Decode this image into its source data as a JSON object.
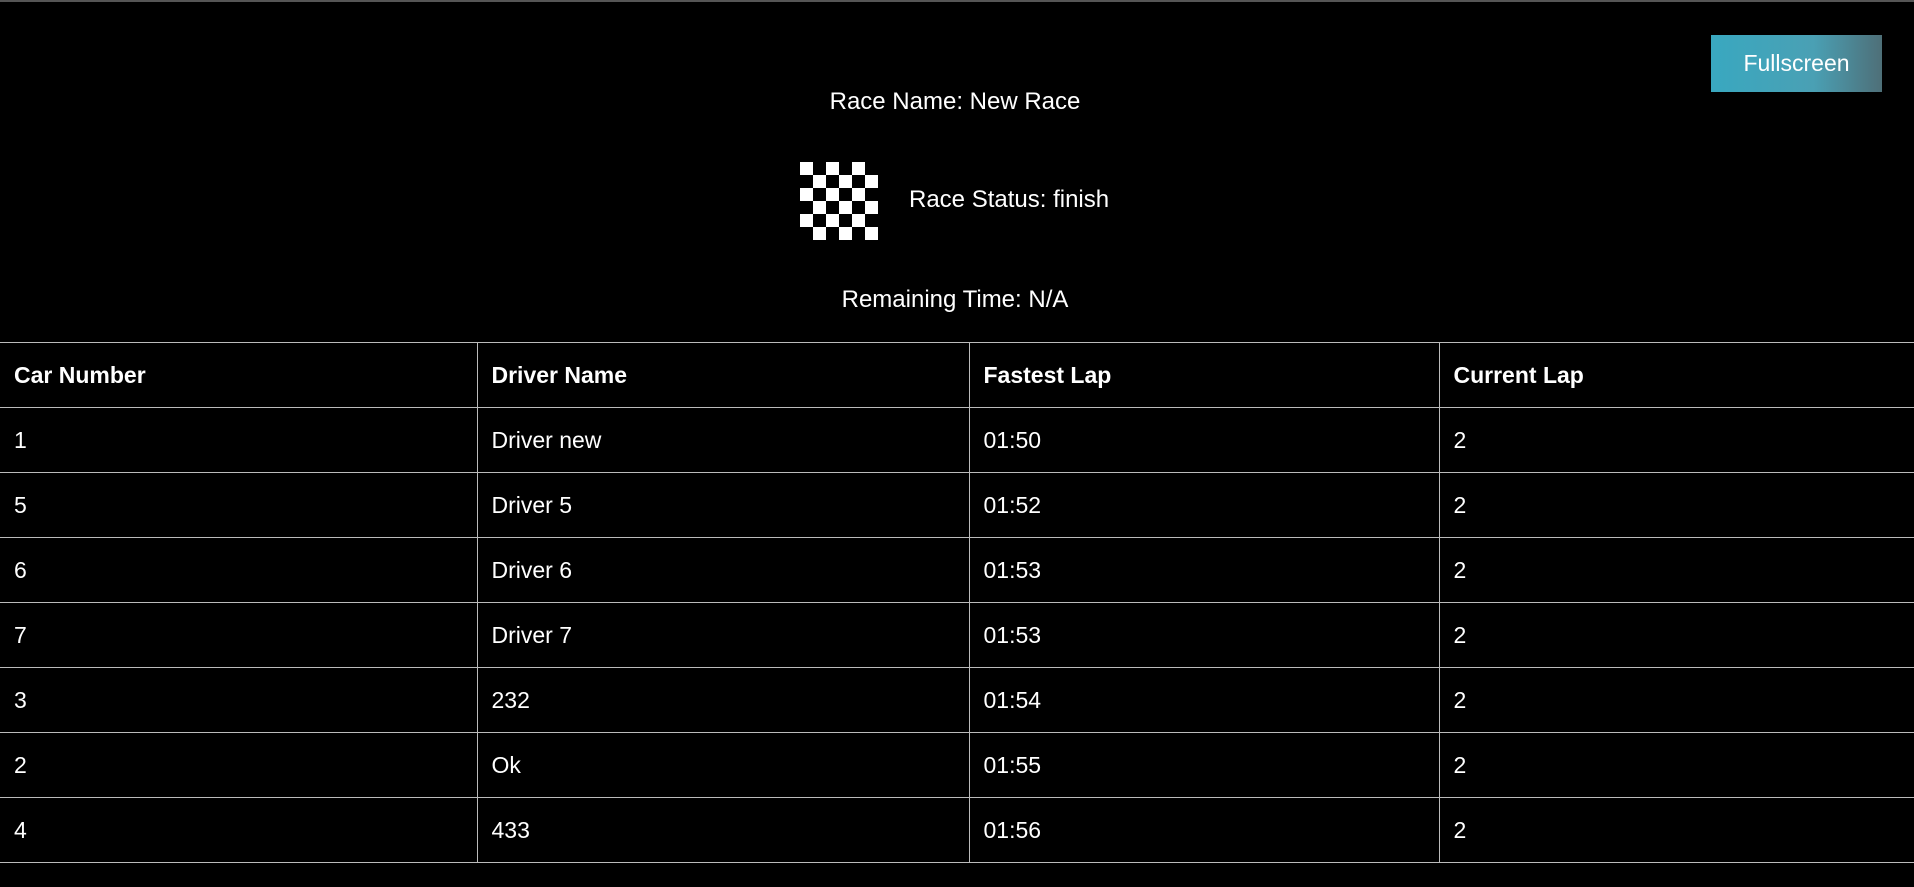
{
  "toolbar": {
    "fullscreen_label": "Fullscreen"
  },
  "race": {
    "name_text": "Race Name: New Race",
    "status_text": "Race Status: finish",
    "remaining_text": "Remaining Time: N/A",
    "flag_icon": "checkered-flag-icon"
  },
  "table": {
    "headers": [
      "Car Number",
      "Driver Name",
      "Fastest Lap",
      "Current Lap"
    ],
    "rows": [
      [
        "1",
        "Driver new",
        "01:50",
        "2"
      ],
      [
        "5",
        "Driver 5",
        "01:52",
        "2"
      ],
      [
        "6",
        "Driver 6",
        "01:53",
        "2"
      ],
      [
        "7",
        "Driver 7",
        "01:53",
        "2"
      ],
      [
        "3",
        "232",
        "01:54",
        "2"
      ],
      [
        "2",
        "Ok",
        "01:55",
        "2"
      ],
      [
        "4",
        "433",
        "01:56",
        "2"
      ]
    ]
  },
  "colors": {
    "background": "#000000",
    "text": "#ffffff",
    "button_gradient_start": "#39a8c0",
    "button_gradient_end": "#4e6f78",
    "grid_line": "#bbbbbb"
  }
}
